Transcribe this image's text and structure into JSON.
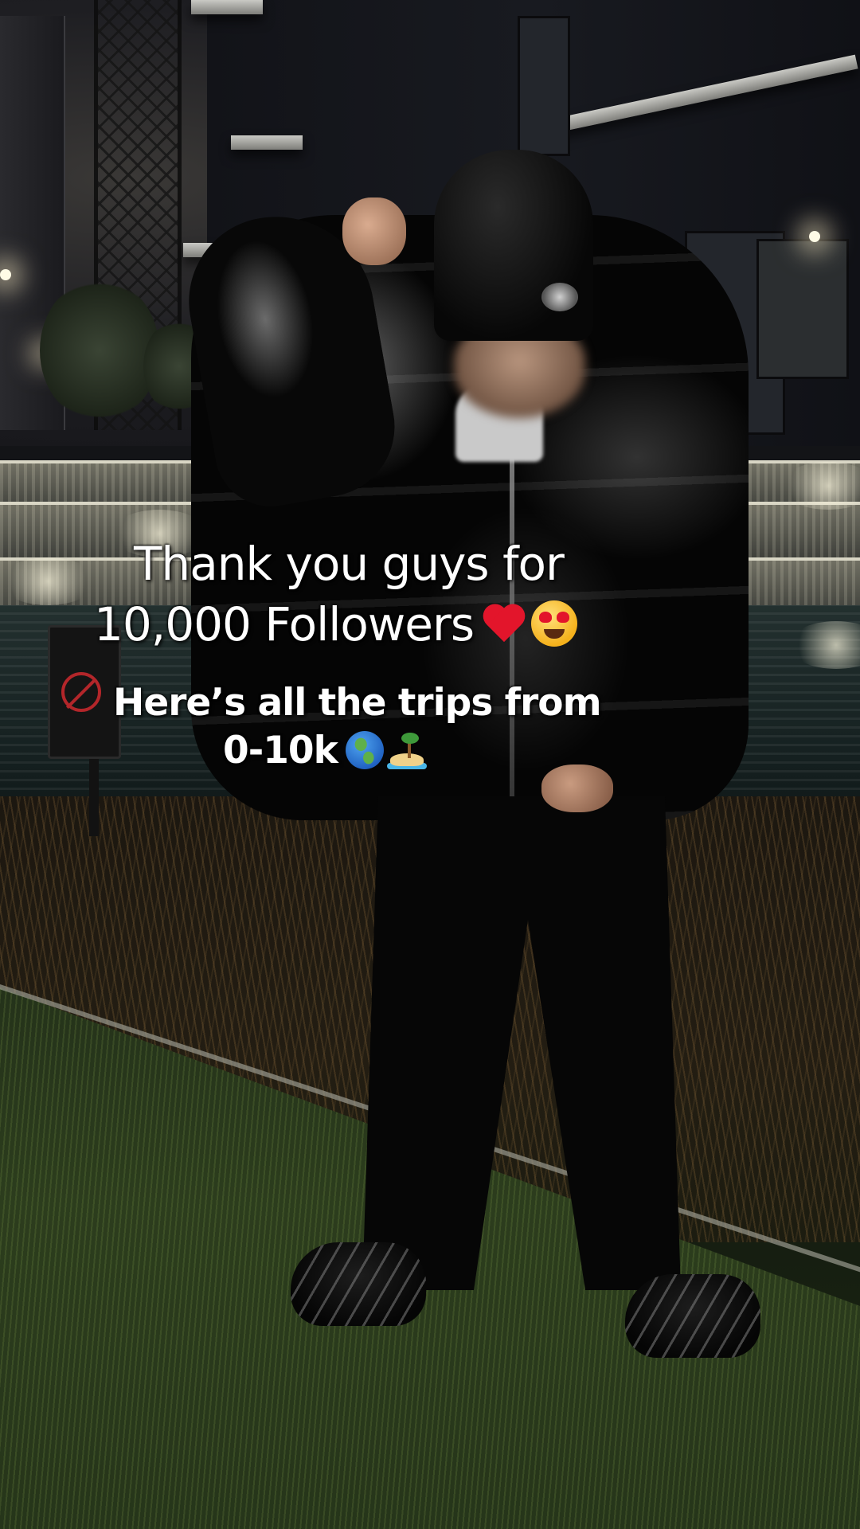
{
  "caption": {
    "title_line_1": "Thank you guys for",
    "title_line_2": "10,000 Followers",
    "title_emojis": [
      "heart-icon",
      "star-eyes-icon"
    ],
    "sub_line_1": "Here’s all the trips from",
    "sub_line_2": "0-10k",
    "sub_emojis": [
      "globe-icon",
      "island-icon"
    ]
  },
  "colors": {
    "caption_text": "#ffffff",
    "heart": "#e3152b"
  }
}
